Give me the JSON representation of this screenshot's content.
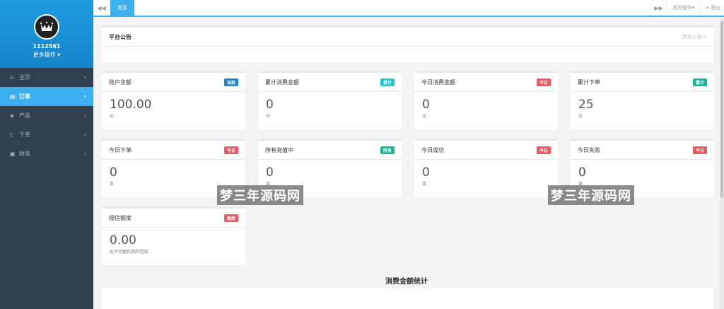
{
  "sidebar": {
    "username": "1112561",
    "more_ops": "更多操作",
    "items": [
      {
        "icon": "home-icon",
        "label": "主页",
        "active": false
      },
      {
        "icon": "document-icon",
        "label": "订单",
        "active": true
      },
      {
        "icon": "cube-icon",
        "label": "产品",
        "active": false
      },
      {
        "icon": "file-icon",
        "label": "下单",
        "active": false
      },
      {
        "icon": "money-icon",
        "label": "财务",
        "active": false
      }
    ]
  },
  "topbar": {
    "home_tab": "首页",
    "close_ops": "关闭操作",
    "logout": "退出"
  },
  "notice": {
    "title": "平台公告",
    "history_link": "历史公告>"
  },
  "cards": [
    {
      "title": "账户余额",
      "badge": "当前",
      "badge_color": "#1c84c6",
      "value": "100.00",
      "unit": "元"
    },
    {
      "title": "累计消费金额",
      "badge": "累计",
      "badge_color": "#23c6c8",
      "value": "0",
      "unit": "元"
    },
    {
      "title": "今日消费金额",
      "badge": "今日",
      "badge_color": "#ed5565",
      "value": "0",
      "unit": "元"
    },
    {
      "title": "累计下单",
      "badge": "累计",
      "badge_color": "#1ab394",
      "value": "25",
      "unit": "次"
    },
    {
      "title": "今日下单",
      "badge": "今日",
      "badge_color": "#ed5565",
      "value": "0",
      "unit": "单"
    },
    {
      "title": "所有充值中",
      "badge": "所有",
      "badge_color": "#1ab394",
      "value": "0",
      "unit": "单"
    },
    {
      "title": "今日成功",
      "badge": "今日",
      "badge_color": "#ed5565",
      "value": "0",
      "unit": "单"
    },
    {
      "title": "今日失败",
      "badge": "今日",
      "badge_color": "#ed5565",
      "value": "0",
      "unit": "单"
    },
    {
      "title": "授信额度",
      "badge": "额度",
      "badge_color": "#ed5565",
      "value": "0.00",
      "unit": "允许余额负数的范围"
    }
  ],
  "section_title": "消费金额统计",
  "watermark": "梦三年源码网"
}
